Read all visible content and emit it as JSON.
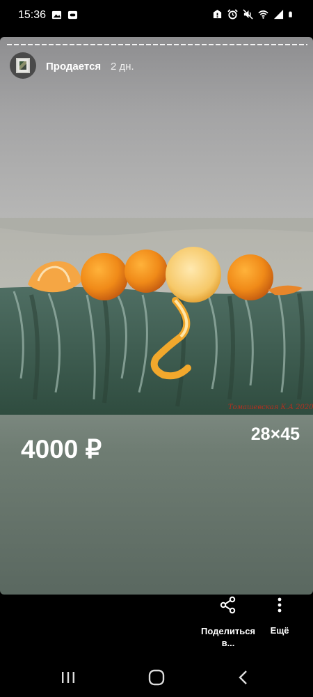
{
  "status_bar": {
    "time": "15:36",
    "left_icons": [
      "gallery-icon",
      "cast-icon"
    ],
    "right_icons": [
      "lock-alert-icon",
      "alarm-icon",
      "mute-icon",
      "wifi-icon",
      "signal-icon",
      "battery-icon"
    ]
  },
  "story": {
    "user_name": "Продается",
    "post_time": "2 дн.",
    "price": "4000 ₽",
    "size": "28×45",
    "painting_signature": "Томашевская К.А 2020"
  },
  "actions": {
    "share_label": "Поделиться в...",
    "more_label": "Ещё"
  },
  "colors": {
    "background": "#000000",
    "story_top": "#8e8e90",
    "story_bottom": "#5a6860",
    "text": "#ffffff"
  }
}
